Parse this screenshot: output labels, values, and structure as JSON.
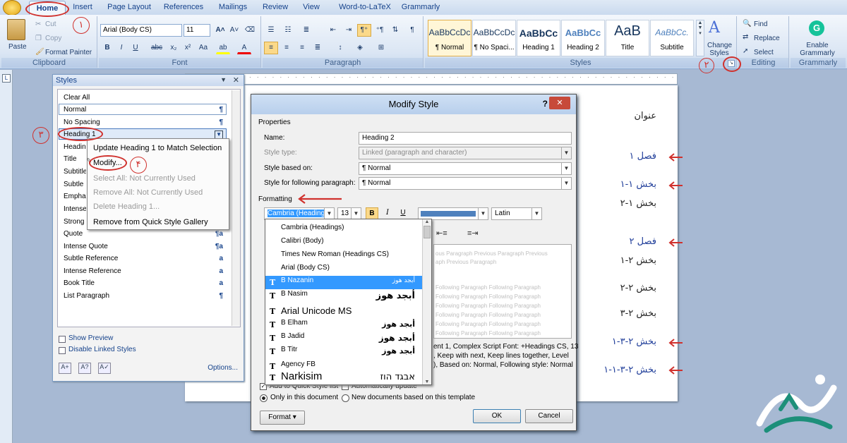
{
  "ribbon": {
    "tabs": [
      "Home",
      "Insert",
      "Page Layout",
      "References",
      "Mailings",
      "Review",
      "View",
      "Word-to-LaTeX",
      "Grammarly"
    ],
    "clipboard": {
      "label": "Clipboard",
      "paste": "Paste",
      "cut": "Cut",
      "copy": "Copy",
      "format_painter": "Format Painter"
    },
    "font": {
      "label": "Font",
      "family": "Arial (Body CS)",
      "size": "11"
    },
    "paragraph": {
      "label": "Paragraph"
    },
    "styles": {
      "label": "Styles",
      "quick": [
        {
          "preview": "AaBbCcDc",
          "name": "¶ Normal"
        },
        {
          "preview": "AaBbCcDc",
          "name": "¶ No Spaci..."
        },
        {
          "preview": "AaBbCc",
          "name": "Heading 1"
        },
        {
          "preview": "AaBbCc",
          "name": "Heading 2"
        },
        {
          "preview": "AaB",
          "name": "Title"
        },
        {
          "preview": "AaBbCc.",
          "name": "Subtitle"
        }
      ],
      "change_styles": "Change Styles"
    },
    "editing": {
      "label": "Editing",
      "find": "Find",
      "replace": "Replace",
      "select": "Select"
    },
    "grammarly": {
      "label": "Grammarly",
      "enable": "Enable Grammarly"
    }
  },
  "styles_pane": {
    "title": "Styles",
    "items": [
      {
        "name": "Clear All",
        "sym": ""
      },
      {
        "name": "Normal",
        "sym": "¶"
      },
      {
        "name": "No Spacing",
        "sym": "¶"
      },
      {
        "name": "Heading 1",
        "sym": "¶a"
      },
      {
        "name": "Heading 2",
        "sym": ""
      },
      {
        "name": "Title",
        "sym": ""
      },
      {
        "name": "Subtitle",
        "sym": ""
      },
      {
        "name": "Subtle Emphasis",
        "sym": ""
      },
      {
        "name": "Emphasis",
        "sym": ""
      },
      {
        "name": "Intense Emphasis",
        "sym": ""
      },
      {
        "name": "Strong",
        "sym": ""
      },
      {
        "name": "Quote",
        "sym": "¶a"
      },
      {
        "name": "Intense Quote",
        "sym": "¶a"
      },
      {
        "name": "Subtle Reference",
        "sym": "a"
      },
      {
        "name": "Intense Reference",
        "sym": "a"
      },
      {
        "name": "Book Title",
        "sym": "a"
      },
      {
        "name": "List Paragraph",
        "sym": "¶"
      }
    ],
    "show_preview": "Show Preview",
    "disable_linked": "Disable Linked Styles",
    "options": "Options..."
  },
  "context_menu": {
    "items": [
      {
        "label": "Update Heading 1 to Match Selection",
        "disabled": false
      },
      {
        "label": "Modify...",
        "disabled": false
      },
      {
        "label": "Select All: Not Currently Used",
        "disabled": true
      },
      {
        "label": "Remove All: Not Currently Used",
        "disabled": true
      },
      {
        "label": "Delete Heading 1...",
        "disabled": true
      },
      {
        "label": "Remove from Quick Style Gallery",
        "disabled": false
      }
    ]
  },
  "modify_dialog": {
    "title": "Modify Style",
    "help": "?",
    "properties": "Properties",
    "name_label": "Name:",
    "name_value": "Heading 2",
    "type_label": "Style type:",
    "type_value": "Linked (paragraph and character)",
    "based_label": "Style based on:",
    "based_value": "¶ Normal",
    "following_label": "Style for following paragraph:",
    "following_value": "¶ Normal",
    "formatting": "Formatting",
    "font_value": "Cambria (Headings)",
    "size_value": "13",
    "script_value": "Latin",
    "preview_prev1": "ous Paragraph Previous Paragraph Previous",
    "preview_prev2": "aph Previous Paragraph",
    "preview_following": "Following Paragraph Following Paragraph",
    "desc1": "ent 1, Complex Script Font: +Headings CS, 13",
    "desc2": ", Keep with next, Keep lines together, Level",
    "desc3": "), Based on: Normal, Following style: Normal",
    "add_quick": "Add to Quick Style list",
    "auto_update": "Automatically update",
    "only_doc": "Only in this document",
    "new_docs": "New documents based on this template",
    "format_btn": "Format",
    "ok": "OK",
    "cancel": "Cancel"
  },
  "font_list": [
    {
      "name": "Cambria (Headings)",
      "sample": "",
      "tt": false
    },
    {
      "name": "Calibri (Body)",
      "sample": "",
      "tt": false
    },
    {
      "name": "Times New Roman (Headings CS)",
      "sample": "",
      "tt": false
    },
    {
      "name": "Arial (Body CS)",
      "sample": "",
      "tt": false
    },
    {
      "name": "B Nazanin",
      "sample": "أبجد هوز",
      "tt": true
    },
    {
      "name": "B Nasim",
      "sample": "أبجد هوز",
      "tt": true
    },
    {
      "name": "Arial Unicode MS",
      "sample": "",
      "tt": true
    },
    {
      "name": "B Elham",
      "sample": "أبجد هوز",
      "tt": true
    },
    {
      "name": "B Jadid",
      "sample": "أبجد هوز",
      "tt": true
    },
    {
      "name": "B Titr",
      "sample": "أبجد هوز",
      "tt": true
    },
    {
      "name": "Agency FB",
      "sample": "",
      "tt": true
    },
    {
      "name": "Narkisim",
      "sample": "אבגד הוז",
      "tt": true
    }
  ],
  "document": {
    "lines": [
      {
        "text": "عنوان",
        "heading": false
      },
      {
        "text": "فصل ۱",
        "heading": true
      },
      {
        "text": "بخش ۱-۱",
        "heading": true
      },
      {
        "text": "بخش ۱-۲",
        "heading": false
      },
      {
        "text": "فصل ۲",
        "heading": true
      },
      {
        "text": "بخش ۲-۱",
        "heading": false
      },
      {
        "text": "بخش ۲-۲",
        "heading": false
      },
      {
        "text": "بخش ۲-۳",
        "heading": false
      },
      {
        "text": "بخش ۲-۳-۱",
        "heading": true
      },
      {
        "text": "بخش ۲-۳-۱-۱",
        "heading": true
      }
    ]
  },
  "annotations": [
    "۱",
    "۲",
    "۳",
    "۴"
  ],
  "colors": {
    "accent": "#d0312d",
    "heading": "#1f3d99",
    "ribbon": "#dbe6f4"
  }
}
